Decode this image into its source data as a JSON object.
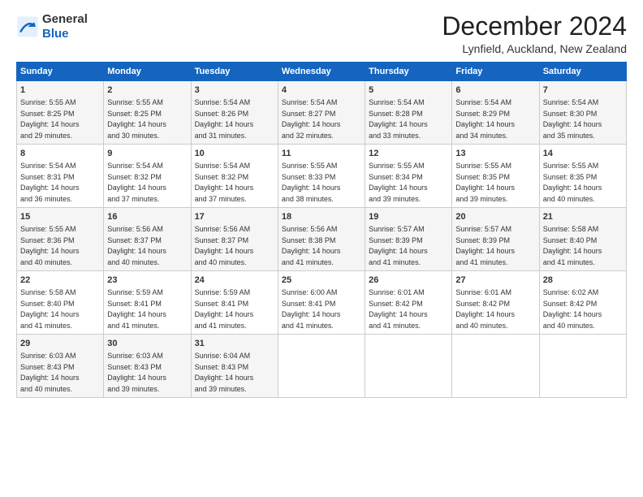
{
  "logo": {
    "general": "General",
    "blue": "Blue"
  },
  "title": "December 2024",
  "location": "Lynfield, Auckland, New Zealand",
  "weekdays": [
    "Sunday",
    "Monday",
    "Tuesday",
    "Wednesday",
    "Thursday",
    "Friday",
    "Saturday"
  ],
  "weeks": [
    [
      {
        "day": "1",
        "sunrise": "5:55 AM",
        "sunset": "8:25 PM",
        "daylight": "14 hours and 29 minutes."
      },
      {
        "day": "2",
        "sunrise": "5:55 AM",
        "sunset": "8:25 PM",
        "daylight": "14 hours and 30 minutes."
      },
      {
        "day": "3",
        "sunrise": "5:54 AM",
        "sunset": "8:26 PM",
        "daylight": "14 hours and 31 minutes."
      },
      {
        "day": "4",
        "sunrise": "5:54 AM",
        "sunset": "8:27 PM",
        "daylight": "14 hours and 32 minutes."
      },
      {
        "day": "5",
        "sunrise": "5:54 AM",
        "sunset": "8:28 PM",
        "daylight": "14 hours and 33 minutes."
      },
      {
        "day": "6",
        "sunrise": "5:54 AM",
        "sunset": "8:29 PM",
        "daylight": "14 hours and 34 minutes."
      },
      {
        "day": "7",
        "sunrise": "5:54 AM",
        "sunset": "8:30 PM",
        "daylight": "14 hours and 35 minutes."
      }
    ],
    [
      {
        "day": "8",
        "sunrise": "5:54 AM",
        "sunset": "8:31 PM",
        "daylight": "14 hours and 36 minutes."
      },
      {
        "day": "9",
        "sunrise": "5:54 AM",
        "sunset": "8:32 PM",
        "daylight": "14 hours and 37 minutes."
      },
      {
        "day": "10",
        "sunrise": "5:54 AM",
        "sunset": "8:32 PM",
        "daylight": "14 hours and 37 minutes."
      },
      {
        "day": "11",
        "sunrise": "5:55 AM",
        "sunset": "8:33 PM",
        "daylight": "14 hours and 38 minutes."
      },
      {
        "day": "12",
        "sunrise": "5:55 AM",
        "sunset": "8:34 PM",
        "daylight": "14 hours and 39 minutes."
      },
      {
        "day": "13",
        "sunrise": "5:55 AM",
        "sunset": "8:35 PM",
        "daylight": "14 hours and 39 minutes."
      },
      {
        "day": "14",
        "sunrise": "5:55 AM",
        "sunset": "8:35 PM",
        "daylight": "14 hours and 40 minutes."
      }
    ],
    [
      {
        "day": "15",
        "sunrise": "5:55 AM",
        "sunset": "8:36 PM",
        "daylight": "14 hours and 40 minutes."
      },
      {
        "day": "16",
        "sunrise": "5:56 AM",
        "sunset": "8:37 PM",
        "daylight": "14 hours and 40 minutes."
      },
      {
        "day": "17",
        "sunrise": "5:56 AM",
        "sunset": "8:37 PM",
        "daylight": "14 hours and 40 minutes."
      },
      {
        "day": "18",
        "sunrise": "5:56 AM",
        "sunset": "8:38 PM",
        "daylight": "14 hours and 41 minutes."
      },
      {
        "day": "19",
        "sunrise": "5:57 AM",
        "sunset": "8:39 PM",
        "daylight": "14 hours and 41 minutes."
      },
      {
        "day": "20",
        "sunrise": "5:57 AM",
        "sunset": "8:39 PM",
        "daylight": "14 hours and 41 minutes."
      },
      {
        "day": "21",
        "sunrise": "5:58 AM",
        "sunset": "8:40 PM",
        "daylight": "14 hours and 41 minutes."
      }
    ],
    [
      {
        "day": "22",
        "sunrise": "5:58 AM",
        "sunset": "8:40 PM",
        "daylight": "14 hours and 41 minutes."
      },
      {
        "day": "23",
        "sunrise": "5:59 AM",
        "sunset": "8:41 PM",
        "daylight": "14 hours and 41 minutes."
      },
      {
        "day": "24",
        "sunrise": "5:59 AM",
        "sunset": "8:41 PM",
        "daylight": "14 hours and 41 minutes."
      },
      {
        "day": "25",
        "sunrise": "6:00 AM",
        "sunset": "8:41 PM",
        "daylight": "14 hours and 41 minutes."
      },
      {
        "day": "26",
        "sunrise": "6:01 AM",
        "sunset": "8:42 PM",
        "daylight": "14 hours and 41 minutes."
      },
      {
        "day": "27",
        "sunrise": "6:01 AM",
        "sunset": "8:42 PM",
        "daylight": "14 hours and 40 minutes."
      },
      {
        "day": "28",
        "sunrise": "6:02 AM",
        "sunset": "8:42 PM",
        "daylight": "14 hours and 40 minutes."
      }
    ],
    [
      {
        "day": "29",
        "sunrise": "6:03 AM",
        "sunset": "8:43 PM",
        "daylight": "14 hours and 40 minutes."
      },
      {
        "day": "30",
        "sunrise": "6:03 AM",
        "sunset": "8:43 PM",
        "daylight": "14 hours and 39 minutes."
      },
      {
        "day": "31",
        "sunrise": "6:04 AM",
        "sunset": "8:43 PM",
        "daylight": "14 hours and 39 minutes."
      },
      null,
      null,
      null,
      null
    ]
  ],
  "labels": {
    "sunrise": "Sunrise:",
    "sunset": "Sunset:",
    "daylight": "Daylight:"
  }
}
